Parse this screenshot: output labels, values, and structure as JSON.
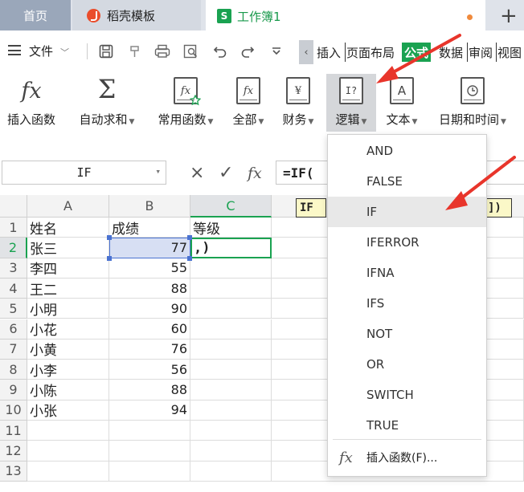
{
  "tabs": {
    "home": "首页",
    "doc": "稻壳模板",
    "workbook": "工作簿1",
    "workbook_icon": "S",
    "add": "+"
  },
  "menu": {
    "file": "文件",
    "tabs": [
      "插入",
      "页面布局",
      "公式",
      "数据",
      "审阅",
      "视图"
    ],
    "active_tab": "公式"
  },
  "ribbon": [
    {
      "label": "插入函数",
      "icon": "fx"
    },
    {
      "label": "自动求和",
      "icon": "Σ",
      "dropdown": true
    },
    {
      "label": "常用函数",
      "icon": "fx-star",
      "dropdown": true
    },
    {
      "label": "全部",
      "icon": "fx-book",
      "dropdown": true
    },
    {
      "label": "财务",
      "icon": "¥",
      "dropdown": true
    },
    {
      "label": "逻辑",
      "icon": "I?",
      "dropdown": true,
      "active": true
    },
    {
      "label": "文本",
      "icon": "A",
      "dropdown": true
    },
    {
      "label": "日期和时间",
      "icon": "clock",
      "dropdown": true
    }
  ],
  "formula_bar": {
    "name_box": "IF",
    "formula": "=IF(",
    "cancel_icon": "×",
    "confirm_icon": "✓",
    "fx_icon": "fx"
  },
  "tooltip": {
    "left": "IF",
    "right": "])"
  },
  "grid": {
    "columns": [
      "A",
      "B",
      "C"
    ],
    "rows": [
      "1",
      "2",
      "3",
      "4",
      "5",
      "6",
      "7",
      "8",
      "9",
      "10",
      "11",
      "12",
      "13"
    ],
    "header": {
      "a": "姓名",
      "b": "成绩",
      "c": "等级"
    },
    "data": [
      {
        "name": "张三",
        "score": "77"
      },
      {
        "name": "李四",
        "score": "55"
      },
      {
        "name": "王二",
        "score": "88"
      },
      {
        "name": "小明",
        "score": "90"
      },
      {
        "name": "小花",
        "score": "60"
      },
      {
        "name": "小黄",
        "score": "76"
      },
      {
        "name": "小李",
        "score": "56"
      },
      {
        "name": "小陈",
        "score": "88"
      },
      {
        "name": "小张",
        "score": "94"
      }
    ],
    "c2_edit": ",)"
  },
  "dropdown": {
    "items": [
      "AND",
      "FALSE",
      "IF",
      "IFERROR",
      "IFNA",
      "IFS",
      "NOT",
      "OR",
      "SWITCH",
      "TRUE"
    ],
    "highlighted": "IF",
    "insert_label": "插入函数(F)...",
    "insert_icon": "fx"
  },
  "colors": {
    "accent_green": "#1aa251",
    "annotation_red": "#e8352b",
    "selection_blue": "#4a72d1"
  }
}
